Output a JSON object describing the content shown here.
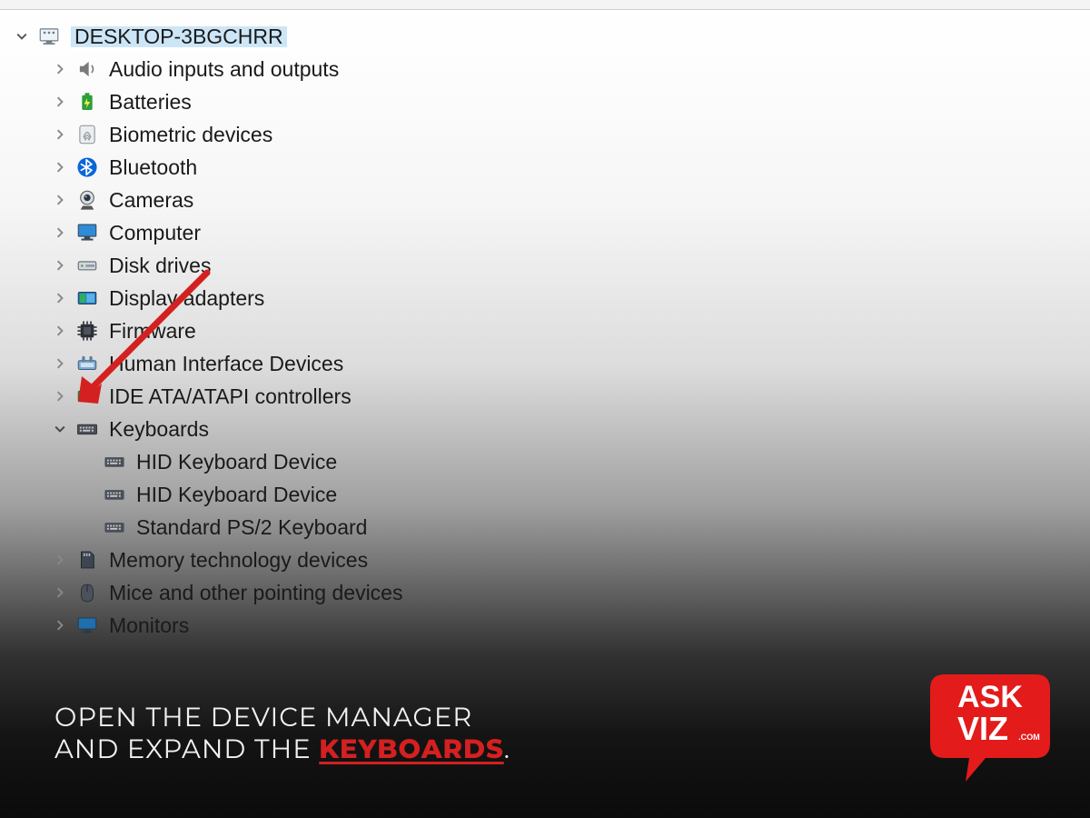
{
  "tree": {
    "root": {
      "label": "DESKTOP-3BGCHRR",
      "expanded": true
    },
    "categories": [
      {
        "id": "audio",
        "label": "Audio inputs and outputs",
        "expanded": false
      },
      {
        "id": "batteries",
        "label": "Batteries",
        "expanded": false
      },
      {
        "id": "biometric",
        "label": "Biometric devices",
        "expanded": false
      },
      {
        "id": "bluetooth",
        "label": "Bluetooth",
        "expanded": false
      },
      {
        "id": "cameras",
        "label": "Cameras",
        "expanded": false
      },
      {
        "id": "computer",
        "label": "Computer",
        "expanded": false
      },
      {
        "id": "disk",
        "label": "Disk drives",
        "expanded": false
      },
      {
        "id": "display",
        "label": "Display adapters",
        "expanded": false
      },
      {
        "id": "firmware",
        "label": "Firmware",
        "expanded": false
      },
      {
        "id": "hid",
        "label": "Human Interface Devices",
        "expanded": false
      },
      {
        "id": "ide",
        "label": "IDE ATA/ATAPI controllers",
        "expanded": false
      },
      {
        "id": "keyboards",
        "label": "Keyboards",
        "expanded": true,
        "children": [
          {
            "label": "HID Keyboard Device"
          },
          {
            "label": "HID Keyboard Device"
          },
          {
            "label": "Standard PS/2 Keyboard"
          }
        ]
      },
      {
        "id": "memory",
        "label": "Memory technology devices",
        "expanded": false
      },
      {
        "id": "mice",
        "label": "Mice and other pointing devices",
        "expanded": false
      },
      {
        "id": "monitors",
        "label": "Monitors",
        "expanded": false
      }
    ]
  },
  "caption": {
    "line1": "OPEN THE DEVICE MANAGER",
    "line2_pre": "AND EXPAND THE ",
    "line2_kw": "KEYBOARDS",
    "line2_post": "."
  },
  "logo": {
    "line1": "ASK",
    "line2": "VIZ",
    "sub": ".COM"
  },
  "annotation": {
    "arrow_color": "#d42020"
  }
}
